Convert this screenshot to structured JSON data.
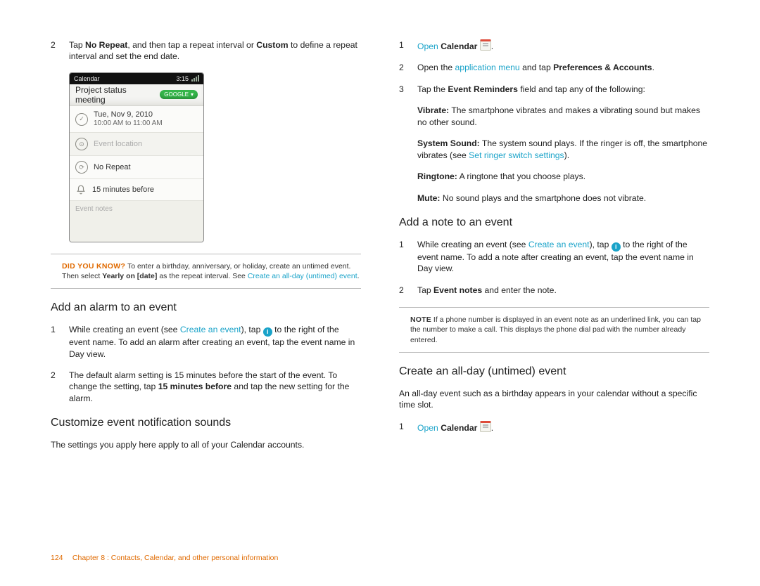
{
  "left": {
    "step2_num": "2",
    "step2_a": "Tap ",
    "step2_b_bold": "No Repeat",
    "step2_c": ", and then tap a repeat interval or ",
    "step2_d_bold": "Custom",
    "step2_e": " to define a repeat interval and set the end date.",
    "phone": {
      "status_left": "Calendar",
      "status_right": "3:15",
      "title": "Project status meeting",
      "pill": "GOOGLE",
      "date_line1": "Tue, Nov 9, 2010",
      "date_line2": "10:00 AM to 11:00 AM",
      "location_placeholder": "Event location",
      "repeat": "No Repeat",
      "alarm": "15 minutes before",
      "notes_placeholder": "Event notes"
    },
    "dyk_lead": "DID YOU KNOW?",
    "dyk_a": "  To enter a birthday, anniversary, or holiday, create an untimed event. Then select ",
    "dyk_b_bold": "Yearly on [date]",
    "dyk_c": " as the repeat interval. See ",
    "dyk_link": "Create an all-day (untimed) event",
    "dyk_d": ".",
    "sec_alarm": "Add an alarm to an event",
    "alarm1_num": "1",
    "alarm1_a": "While creating an event (see ",
    "alarm1_link": "Create an event",
    "alarm1_b": "), tap ",
    "alarm1_c": " to the right of the event name. To add an alarm after creating an event, tap the event name in Day view.",
    "alarm2_num": "2",
    "alarm2_a": "The default alarm setting is 15 minutes before the start of the event. To change the setting, tap ",
    "alarm2_b_bold": "15 minutes before",
    "alarm2_c": " and tap the new setting for the alarm.",
    "sec_sounds": "Customize event notification sounds",
    "sounds_para": "The settings you apply here apply to all of your Calendar accounts."
  },
  "right": {
    "s1_num": "1",
    "s1_open": "Open",
    "s1_cal_bold": "Calendar",
    "s1_dot": ".",
    "s2_num": "2",
    "s2_a": "Open the ",
    "s2_link": "application menu",
    "s2_b": " and tap ",
    "s2_c_bold": "Preferences & Accounts",
    "s2_d": ".",
    "s3_num": "3",
    "s3_a": "Tap the ",
    "s3_b_bold": "Event Reminders",
    "s3_c": " field and tap any of the following:",
    "vibrate_b": "Vibrate:",
    "vibrate_t": " The smartphone vibrates and makes a vibrating sound but makes no other sound.",
    "syssound_b": "System Sound:",
    "syssound_t": " The system sound plays. If the ringer is off, the smartphone vibrates (see ",
    "syssound_link": "Set ringer switch settings",
    "syssound_t2": ").",
    "ringtone_b": "Ringtone:",
    "ringtone_t": " A ringtone that you choose plays.",
    "mute_b": "Mute:",
    "mute_t": " No sound plays and the smartphone does not vibrate.",
    "sec_note": "Add a note to an event",
    "note1_num": "1",
    "note1_a": "While creating an event (see ",
    "note1_link": "Create an event",
    "note1_b": "), tap ",
    "note1_c": " to the right of the event name. To add a note after creating an event, tap the event name in Day view.",
    "note2_num": "2",
    "note2_a": "Tap ",
    "note2_b_bold": "Event notes",
    "note2_c": " and enter the note.",
    "note_callout_lead": "NOTE",
    "note_callout_body": "  If a phone number is displayed in an event note as an underlined link, you can tap the number to make a call. This displays the phone dial pad with the number already entered.",
    "sec_allday": "Create an all-day (untimed) event",
    "allday_para": "An all-day event such as a birthday appears in your calendar without a specific time slot.",
    "ad1_num": "1",
    "ad1_open": "Open",
    "ad1_cal_bold": "Calendar",
    "ad1_dot": "."
  },
  "footer": {
    "page": "124",
    "text": "Chapter 8 : Contacts, Calendar, and other personal information"
  }
}
